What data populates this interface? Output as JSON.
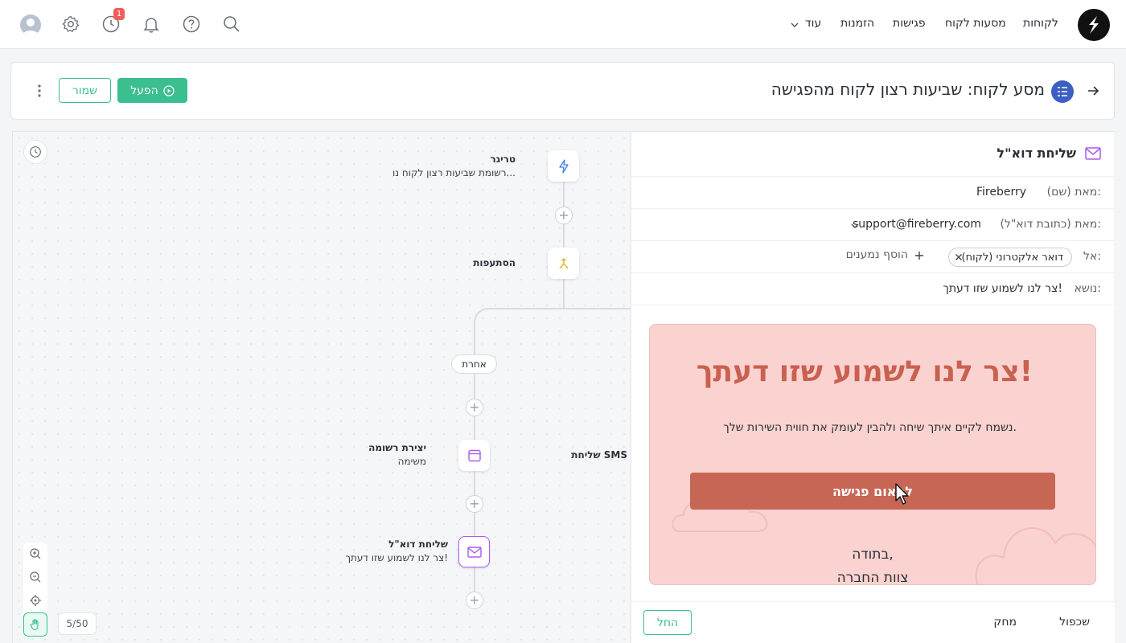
{
  "nav": {
    "links": [
      "לקוחות",
      "מסעות לקוח",
      "פגישות",
      "הזמנות",
      "עוד"
    ],
    "notification_count": "1"
  },
  "header": {
    "title": "מסע לקוח: שביעות רצון לקוח מהפגישה",
    "activate_label": "הפעל",
    "save_label": "שמור"
  },
  "canvas": {
    "trigger": {
      "title": "טריגר",
      "subtitle": "רשומת שביעות רצון לקוח נו..."
    },
    "branches": {
      "title": "הסתעפות"
    },
    "branch_other": "אחרת",
    "create_record": {
      "title": "יצירת רשומה",
      "subtitle": "משימה"
    },
    "send_sms": {
      "title": "שליחת SMS"
    },
    "send_email": {
      "title": "שליחת דוא\"ל",
      "subtitle": "צר לנו לשמוע שזו דעתך!"
    },
    "page_counter": "5/50"
  },
  "panel": {
    "title": "שליחת דוא\"ל",
    "from_name_label": "מאת (שם):",
    "from_name_value": "Fireberry",
    "from_email_label": "מאת (כתובת דוא\"ל):",
    "from_email_value": "support@fireberry.com",
    "to_label": "אל:",
    "to_chip": "דואר אלקטרוני (לקוח)",
    "add_recipients": "הוסף נמענים",
    "subject_label": "נושא:",
    "subject_value": "צר לנו לשמוע שזו דעתך!",
    "email": {
      "heading": "צר לנו לשמוע שזו דעתך!",
      "body": "נשמח לקיים איתך שיחה ולהבין לעומק את חווית השירות שלך.",
      "cta": "לתאום פגישה",
      "sign_line1": "בתודה,",
      "sign_line2": "צוות החברה"
    },
    "footer": {
      "duplicate": "שכפול",
      "delete": "מחק",
      "replace": "החל"
    }
  },
  "colors": {
    "accent": "#3bbf8e",
    "email_bg": "#fad2cf",
    "email_heading": "#c96050",
    "email_cta": "#c86656",
    "selected_node": "#a95be8"
  }
}
